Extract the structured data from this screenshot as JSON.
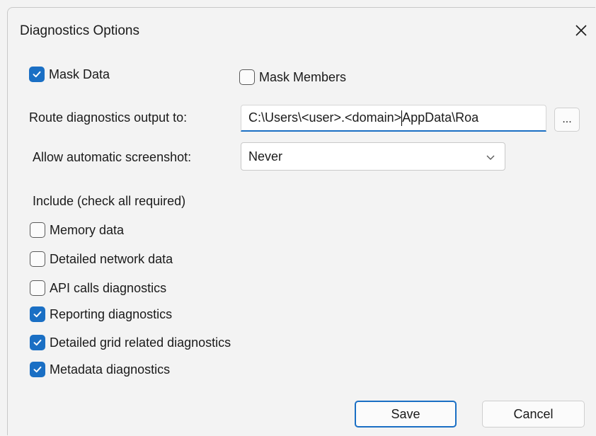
{
  "dialog": {
    "title": "Diagnostics Options",
    "close_label": "Close"
  },
  "mask": {
    "mask_data": {
      "label": "Mask Data",
      "checked": true
    },
    "mask_members": {
      "label": "Mask Members",
      "checked": false
    }
  },
  "route": {
    "label": "Route diagnostics output to:",
    "value_before_caret": "C:\\Users\\<user>.<domain>",
    "value_after_caret": "AppData\\Roa",
    "browse_label": "..."
  },
  "screenshot": {
    "label": "Allow automatic screenshot:",
    "selected": "Never"
  },
  "include": {
    "heading": "Include (check all required)",
    "items": [
      {
        "label": "Memory data",
        "checked": false
      },
      {
        "label": "Detailed network data",
        "checked": false
      },
      {
        "label": "API calls diagnostics",
        "checked": false
      },
      {
        "label": "Reporting diagnostics",
        "checked": true
      },
      {
        "label": "Detailed grid related diagnostics",
        "checked": true
      },
      {
        "label": "Metadata diagnostics",
        "checked": true
      }
    ]
  },
  "buttons": {
    "save": "Save",
    "cancel": "Cancel"
  },
  "colors": {
    "accent": "#1a6fc4",
    "background": "#f3f3f3"
  }
}
